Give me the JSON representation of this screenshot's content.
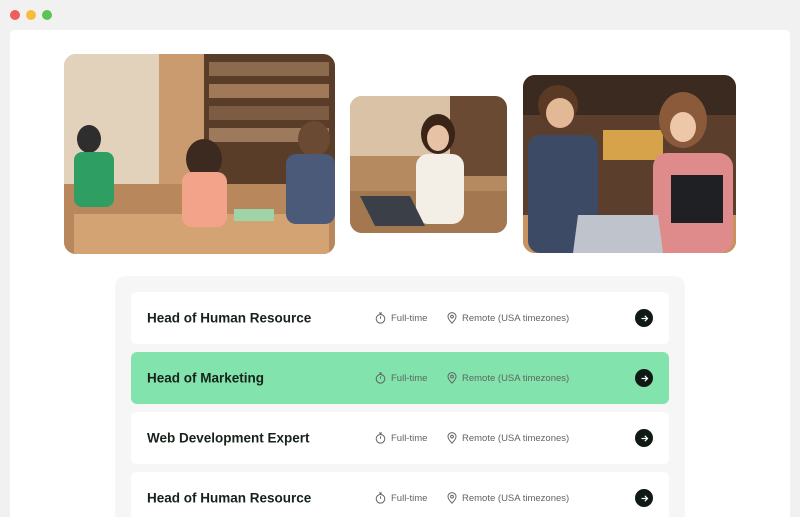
{
  "window": {
    "controls": [
      "close",
      "minimize",
      "maximize"
    ]
  },
  "photos": [
    {
      "name": "team-working-at-table-photo"
    },
    {
      "name": "woman-with-laptop-photo"
    },
    {
      "name": "man-and-woman-with-laptop-photo"
    }
  ],
  "jobs": [
    {
      "title": "Head of Human Resource",
      "type": "Full-time",
      "location": "Remote (USA timezones)",
      "highlighted": false
    },
    {
      "title": "Head of Marketing",
      "type": "Full-time",
      "location": "Remote (USA timezones)",
      "highlighted": true
    },
    {
      "title": "Web Development Expert",
      "type": "Full-time",
      "location": "Remote (USA timezones)",
      "highlighted": false
    },
    {
      "title": "Head of Human Resource",
      "type": "Full-time",
      "location": "Remote (USA timezones)",
      "highlighted": false
    }
  ],
  "icons": {
    "type": "stopwatch-icon",
    "location": "map-pin-icon",
    "action": "arrow-right-icon"
  },
  "colors": {
    "highlight": "#82e3ad",
    "button": "#0f1a14",
    "title": "#16221a"
  }
}
